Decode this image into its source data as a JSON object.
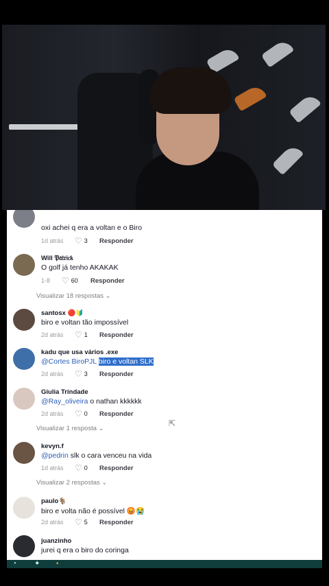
{
  "comments": [
    {
      "text": "oxi achei q era a voltan e o Biro",
      "time": "1d atrás",
      "likes": "3",
      "reply": "Responder"
    },
    {
      "username": "Will 𝔓𝔞𝔱𝔯𝔦𝔠𝔨",
      "text": "O golf já tenho AKAKAK",
      "time": "1-8",
      "likes": "60",
      "reply": "Responder",
      "view_replies": "Visualizar 18 respostas ⌄"
    },
    {
      "username": "santosx 🔴🔰",
      "text": "biro e voltan tão impossível",
      "time": "2d atrás",
      "likes": "1",
      "reply": "Responder"
    },
    {
      "username": "kadu que usa vários .exe",
      "mention": "@Cortes BiroPJL",
      "highlight": "biro e voltan SLK",
      "time": "2d atrás",
      "likes": "3",
      "reply": "Responder"
    },
    {
      "username": "Giulia Trindade",
      "mention": "@Ray_oliveira",
      "text": "o nathan kkkkkk",
      "time": "2d atrás",
      "likes": "0",
      "reply": "Responder",
      "view_replies": "Visualizar 1 resposta ⌄"
    },
    {
      "username": "kevyn.f",
      "mention": "@pedrin",
      "text": "slk o cara venceu na vida",
      "time": "1d atrás",
      "likes": "0",
      "reply": "Responder",
      "view_replies": "Visualizar 2 respostas ⌄"
    },
    {
      "username": "paulo🐐",
      "text": "biro e volta não é possível 😡😭",
      "time": "2d atrás",
      "likes": "5",
      "reply": "Responder"
    },
    {
      "username": "juanzinho",
      "text": "jurei q era o biro do coringa"
    }
  ],
  "colors": {
    "mention": "#2b5db8",
    "highlight": "#2f6ecb",
    "bottom_bar": "#0f3d3b"
  },
  "icons": {
    "like": "heart-outline-icon",
    "cursor": "mouse-pointer-icon"
  }
}
